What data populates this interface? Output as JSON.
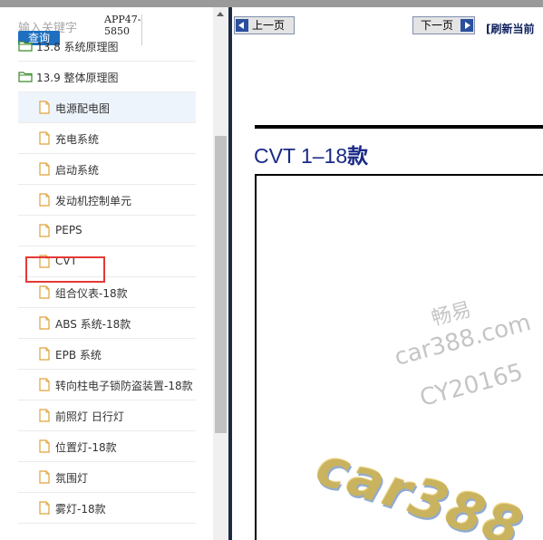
{
  "search": {
    "placeholder": "输入关键字",
    "button_label": "查询",
    "app_code": "APP47-5850"
  },
  "tree": {
    "items": [
      {
        "type": "folder",
        "label": "13.8 系统原理图"
      },
      {
        "type": "folder",
        "label": "13.9 整体原理图"
      },
      {
        "type": "doc",
        "label": "电源配电图",
        "active": true
      },
      {
        "type": "doc",
        "label": "充电系统"
      },
      {
        "type": "doc",
        "label": "启动系统"
      },
      {
        "type": "doc",
        "label": "发动机控制单元"
      },
      {
        "type": "doc",
        "label": "PEPS"
      },
      {
        "type": "doc",
        "label": "CVT",
        "highlighted": true
      },
      {
        "type": "doc",
        "label": "组合仪表-18款"
      },
      {
        "type": "doc",
        "label": "ABS 系统-18款"
      },
      {
        "type": "doc",
        "label": "EPB 系统"
      },
      {
        "type": "doc",
        "label": "转向柱电子锁防盗装置-18款"
      },
      {
        "type": "doc",
        "label": "前照灯 日行灯"
      },
      {
        "type": "doc",
        "label": "位置灯-18款"
      },
      {
        "type": "doc",
        "label": "氛围灯"
      },
      {
        "type": "doc",
        "label": "雾灯-18款"
      }
    ]
  },
  "toolbar": {
    "prev_label": "上一页",
    "next_label": "下一页",
    "refresh_label": "[刷新当前"
  },
  "document": {
    "title_prefix": "CVT 1–18",
    "title_suffix": "款",
    "watermark_1": "畅易",
    "watermark_2": "car388.com",
    "watermark_3": "CY20165",
    "watermark_big": "car388"
  },
  "colors": {
    "search_button": "#1e6fc0",
    "highlight_border": "#e53935",
    "title_text": "#1a2a86",
    "divider": "#1e2a45",
    "active_row_bg": "#eef4fb"
  }
}
